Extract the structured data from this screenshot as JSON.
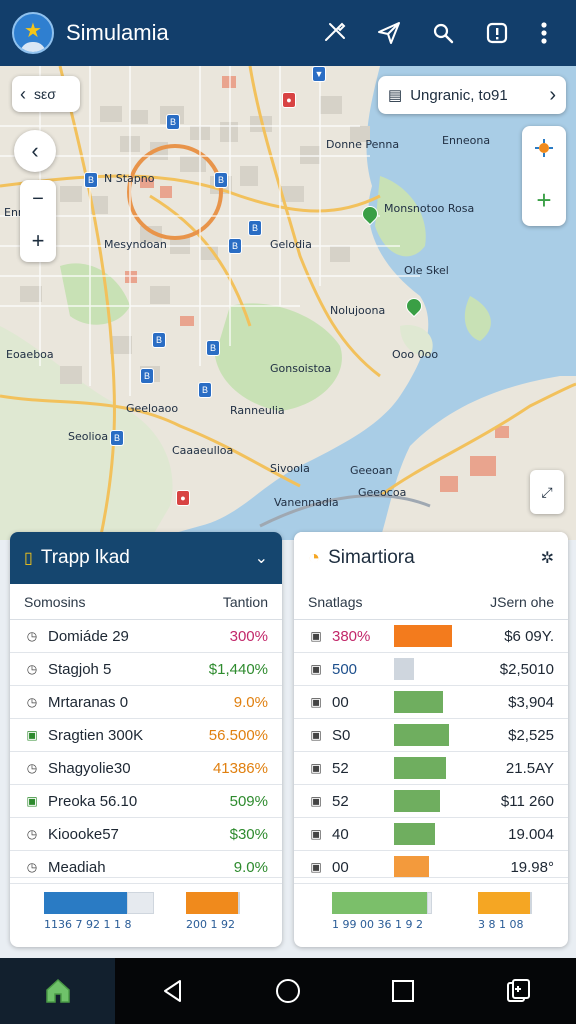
{
  "app": {
    "title": "Simulamia"
  },
  "map": {
    "back_label": "sεσ",
    "route_label": "Ungranic, to91",
    "labels": [
      "Ν Stapno",
      "Donne Penna",
      "Ennr Mlia",
      "Mesyndoan",
      "Gelodia",
      "Monsnotoo Rosa",
      "Ole Skel",
      "Nolujoona",
      "Enneona",
      "Gonsoistoa",
      "Geeloaoo",
      "Ranneulia",
      "Seolioa",
      "Caaaeulloa",
      "Geeoan",
      "Sivoola",
      "Vanennadia",
      "Geeocoa",
      "Eoaeboa",
      "Ooo 0oo"
    ]
  },
  "left_panel": {
    "title": "Trapp lkad",
    "col1": "Somosins",
    "col2": "Tantion",
    "rows": [
      {
        "icon": "clock-icon",
        "name": "Domiáde 29",
        "value": "300%",
        "color": "#c2286a"
      },
      {
        "icon": "clock-icon",
        "name": "Stagjoh 5",
        "value": "$1,440%",
        "color": "#2e8b2e"
      },
      {
        "icon": "clock-icon",
        "name": "Mrtaranas 0",
        "value": "9.0%",
        "color": "#e08010"
      },
      {
        "icon": "badge-icon",
        "name": "Sragtien 300K",
        "value": "56.500%",
        "color": "#e08010"
      },
      {
        "icon": "clock-icon",
        "name": "Shagyolie30",
        "value": "41386%",
        "color": "#e08010"
      },
      {
        "icon": "badge-icon",
        "name": "Preoka 56.10",
        "value": "509%",
        "color": "#2e8b2e"
      },
      {
        "icon": "clock-icon",
        "name": "Kioooke57",
        "value": "$30%",
        "color": "#2e8b2e"
      },
      {
        "icon": "clock-icon",
        "name": "Meadiah",
        "value": "9.0%",
        "color": "#2e8b2e"
      }
    ],
    "footer": [
      {
        "label": "1136  7 92  1 1 8",
        "fill": 0.75,
        "color": "#2a7bc4"
      },
      {
        "label": "200  1 92",
        "fill": 1.0,
        "color": "#f08a1c"
      }
    ]
  },
  "right_panel": {
    "title": "Simartiora",
    "col1": "Snatlags",
    "col2": "JSern ohe",
    "rows": [
      {
        "name": "380%",
        "name_color": "#c2286a",
        "fill": 1.0,
        "bar_color": "#f37b1d",
        "value": "$6 09Y."
      },
      {
        "name": "500",
        "name_color": "#1d4f8c",
        "fill": 0.35,
        "bar_color": "#cfd6de",
        "value": "$2,5010"
      },
      {
        "name": "00",
        "name_color": "#1d2733",
        "fill": 0.85,
        "bar_color": "#6fae5f",
        "value": "$3,904"
      },
      {
        "name": "S0",
        "name_color": "#1d2733",
        "fill": 0.95,
        "bar_color": "#6fae5f",
        "value": "$2,525"
      },
      {
        "name": "52",
        "name_color": "#1d2733",
        "fill": 0.9,
        "bar_color": "#6fae5f",
        "value": "21.5AY"
      },
      {
        "name": "52",
        "name_color": "#1d2733",
        "fill": 0.8,
        "bar_color": "#6fae5f",
        "value": "$11 260"
      },
      {
        "name": "40",
        "name_color": "#1d2733",
        "fill": 0.7,
        "bar_color": "#6fae5f",
        "value": "19.004"
      },
      {
        "name": "00",
        "name_color": "#1d2733",
        "fill": 0.6,
        "bar_color": "#f39a3c",
        "value": "19.98°"
      }
    ],
    "footer": [
      {
        "label": "1 99  00 36  1 9 2",
        "fill": 0.95,
        "color": "#7bbf6a"
      },
      {
        "label": "3 8  1 08",
        "fill": 1.0,
        "color": "#f5a623"
      }
    ]
  }
}
